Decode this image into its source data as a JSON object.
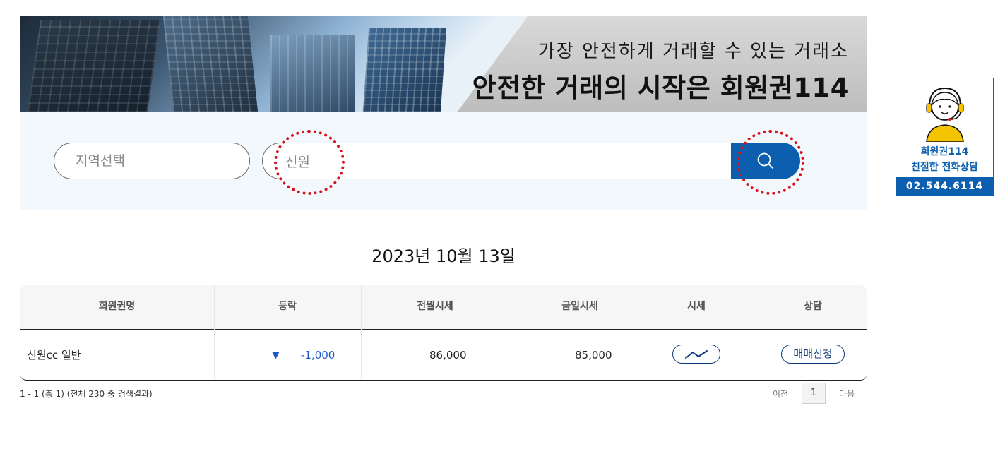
{
  "banner": {
    "subtitle": "가장 안전하게 거래할 수 있는 거래소",
    "title": "안전한 거래의 시작은 회원권114"
  },
  "search": {
    "region_placeholder": "지역선택",
    "query_value": "신원",
    "button_icon": "search-icon"
  },
  "date": "2023년 10월 13일",
  "table": {
    "headers": [
      "회원권명",
      "등락",
      "전월시세",
      "금일시세",
      "시세",
      "상담"
    ],
    "rows": [
      {
        "name": "신원cc 일반",
        "direction_icon": "triangle-down-icon",
        "change": "-1,000",
        "prev_month_price": "86,000",
        "today_price": "85,000",
        "chart_icon": "trend-chart-icon",
        "action": "매매신청"
      }
    ]
  },
  "result_info": "1 - 1 (총 1) (전체 230 중 검색결과)",
  "pagination": {
    "prev": "이전",
    "current": "1",
    "next": "다음"
  },
  "side_widget": {
    "line1": "회원권114",
    "line2": "친절한 전화상담",
    "phone": "02.544.6114"
  },
  "colors": {
    "primary": "#0c5fae",
    "highlight_ring": "#d8121b",
    "negative_change": "#1d59c7"
  }
}
